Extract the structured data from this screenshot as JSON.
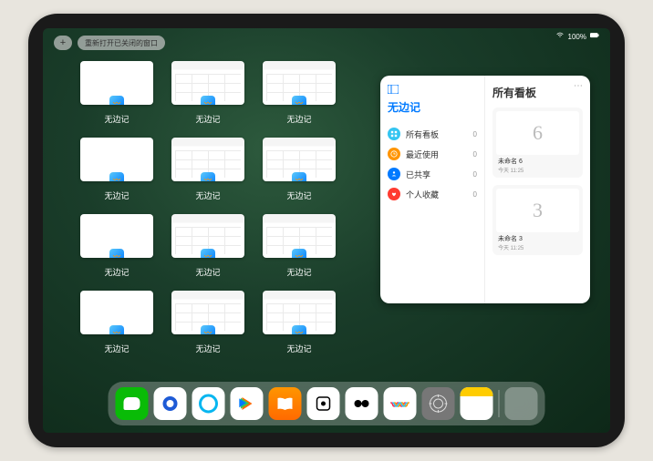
{
  "status": {
    "battery": "100%"
  },
  "topbar": {
    "plus": "+",
    "reopen": "重新打开已关闭的窗口"
  },
  "app_name": "无边记",
  "windows": [
    {
      "label": "无边记",
      "variant": "blank"
    },
    {
      "label": "无边记",
      "variant": "content"
    },
    {
      "label": "无边记",
      "variant": "content"
    },
    {
      "label": "无边记",
      "variant": "blank"
    },
    {
      "label": "无边记",
      "variant": "content"
    },
    {
      "label": "无边记",
      "variant": "content"
    },
    {
      "label": "无边记",
      "variant": "blank"
    },
    {
      "label": "无边记",
      "variant": "content"
    },
    {
      "label": "无边记",
      "variant": "content"
    },
    {
      "label": "无边记",
      "variant": "blank"
    },
    {
      "label": "无边记",
      "variant": "content"
    },
    {
      "label": "无边记",
      "variant": "content"
    }
  ],
  "panel": {
    "title": "无边记",
    "right_title": "所有看板",
    "nav": [
      {
        "icon": "grid-icon",
        "label": "所有看板",
        "count": "0"
      },
      {
        "icon": "clock-icon",
        "label": "最近使用",
        "count": "0"
      },
      {
        "icon": "share-icon",
        "label": "已共享",
        "count": "0"
      },
      {
        "icon": "heart-icon",
        "label": "个人收藏",
        "count": "0"
      }
    ],
    "boards": [
      {
        "glyph": "6",
        "name": "未命名 6",
        "date": "今天 11:25"
      },
      {
        "glyph": "3",
        "name": "未命名 3",
        "date": "今天 11:25"
      }
    ]
  },
  "dock": {
    "apps": [
      "wechat",
      "qq",
      "qqbrowser",
      "play",
      "books",
      "dice",
      "yuan",
      "freeform",
      "settings",
      "notes"
    ],
    "suggestions": true
  }
}
